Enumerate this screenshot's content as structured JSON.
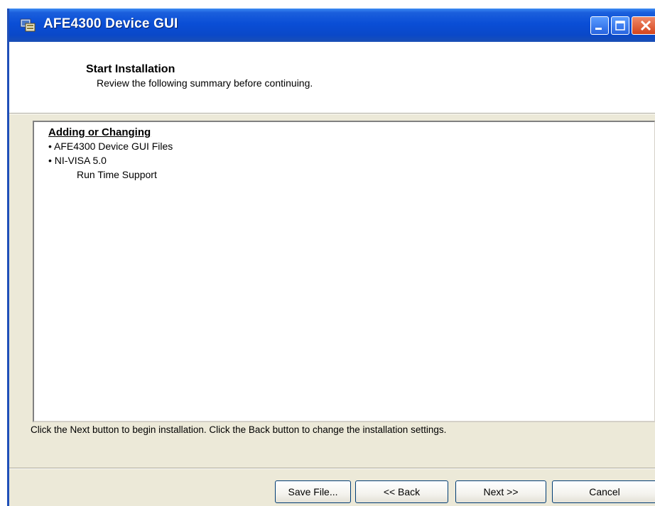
{
  "window": {
    "title": "AFE4300 Device GUI",
    "icon": "installer-icon",
    "controls": [
      "minimize-icon",
      "maximize-icon",
      "close-icon"
    ]
  },
  "header": {
    "title": "Start Installation",
    "subtitle": "Review the following summary before continuing."
  },
  "summary": {
    "heading": "Adding or Changing",
    "items": [
      "• AFE4300 Device GUI Files",
      "• NI-VISA 5.0",
      "Run Time Support"
    ]
  },
  "instruction": "Click the Next button to begin installation.  Click the Back button to change the installation settings.",
  "buttons": {
    "save": "Save File...",
    "back": "<< Back",
    "next": "Next >>",
    "cancel": "Cancel"
  },
  "colors": {
    "titlebar": "#0a4ed6",
    "dialog_bg": "#ece9d8",
    "button_border": "#003c74",
    "close_button": "#d4441c"
  }
}
